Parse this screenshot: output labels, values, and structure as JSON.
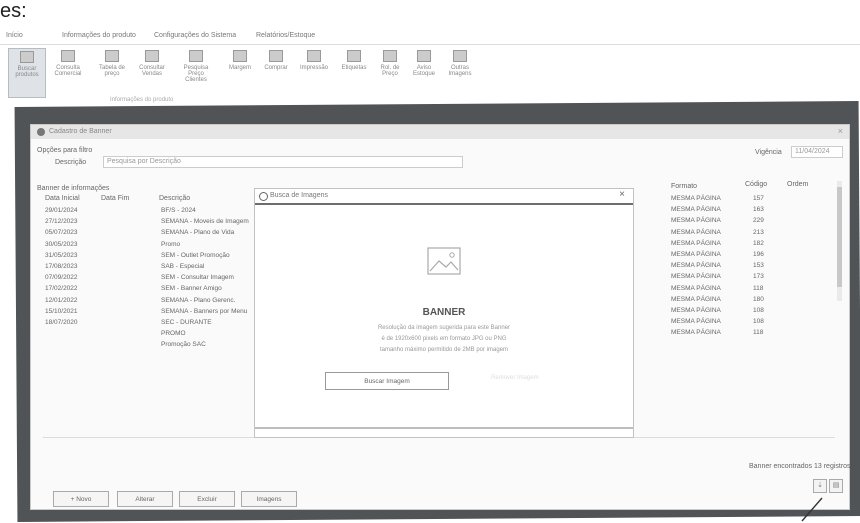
{
  "caption": "es:",
  "ribbon": {
    "tabs": [
      "Início",
      "Informações do produto",
      "Configurações do Sistema",
      "Relatórios/Estoque"
    ],
    "buttons": [
      "Buscar produtos",
      "Consulta Comercial",
      "Tabela de preço",
      "Consultar Vendas",
      "Pesquisa Preço Clientes",
      "Margem",
      "Comprar",
      "Impressão",
      "Etiquetas",
      "Rol. de Preço",
      "Aviso Estoque",
      "Outras Imagens"
    ],
    "group_label": "Informações do produto"
  },
  "window": {
    "title": "Cadastro de Banner",
    "close": "×",
    "search_label": "Opções para filtro",
    "description_label": "Descrição",
    "description_value": "Pesquisa por Descrição",
    "validity_label": "Vigência",
    "validity_value": "11/04/2024",
    "table_label": "Banner de informações",
    "col_headers": [
      "Data Inicial",
      "Data Fim",
      "Descrição"
    ],
    "dates": [
      "29/01/2024",
      "27/12/2023",
      "05/07/2023",
      "30/05/2023",
      "31/05/2023",
      "17/08/2023",
      "07/09/2022",
      "17/02/2022",
      "12/01/2022",
      "15/10/2021",
      "18/07/2020"
    ],
    "descriptions": [
      "BF/S - 2024",
      "SEMANA - Moveis de Imagem",
      "SEMANA - Plano de Vida",
      "Promo",
      "SEM - Outlet Promoção",
      "SAB - Especial",
      "SEM - Consultar Imagem",
      "SEM - Banner Amigo",
      "SEMANA - Plano Gerenc.",
      "SEMANA - Banners por Menu",
      "SEC - DURANTE",
      "PROMO",
      "Promoção SAC"
    ],
    "right_headers": [
      "Formato",
      "Código",
      "Ordem"
    ],
    "formats": [
      "MESMA PÁGINA",
      "MESMA PÁGINA",
      "MESMA PÁGINA",
      "MESMA PÁGINA",
      "MESMA PÁGINA",
      "MESMA PÁGINA",
      "MESMA PÁGINA",
      "MESMA PÁGINA",
      "MESMA PÁGINA",
      "MESMA PÁGINA",
      "MESMA PÁGINA",
      "MESMA PÁGINA",
      "MESMA PÁGINA"
    ],
    "codes": [
      "157",
      "163",
      "229",
      "213",
      "182",
      "196",
      "153",
      "173",
      "118",
      "180",
      "108",
      "108",
      "118"
    ],
    "status": "Banner encontrados 13 registros",
    "footer_buttons": [
      "+ Novo",
      "Alterar",
      "Excluir",
      "Imagens"
    ]
  },
  "dialog": {
    "title": "Busca de Imagens",
    "close": "×",
    "banner_title": "BANNER",
    "lines": [
      "Resolução da imagem sugerida para este Banner",
      "é de 1920x600 pixels em formato JPG ou PNG",
      "tamanho máximo permitido de 2MB por imagem"
    ],
    "button": "Buscar Imagem",
    "button2": "Remover Imagem"
  },
  "colors": {
    "frame": "#505456",
    "window_bg": "#fafafa"
  }
}
